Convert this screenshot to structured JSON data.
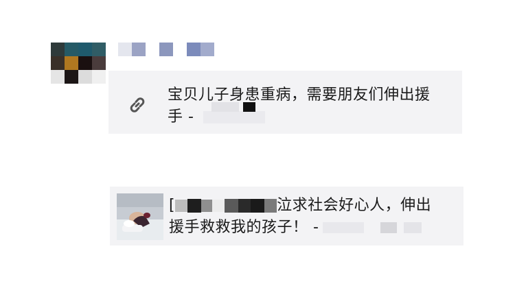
{
  "post1": {
    "link_title_line1": "宝贝儿子身患重病，需要朋友们伸出援",
    "link_title_line2": "手 -"
  },
  "post2": {
    "video_title_prefix": "[",
    "video_title_line1_suffix": "泣求社会好心人，伸出",
    "video_title_line2": "援手救救我的孩子！ -"
  },
  "icons": {
    "link": "link-icon",
    "thumbnail": "child-in-hospital-thumbnail"
  }
}
